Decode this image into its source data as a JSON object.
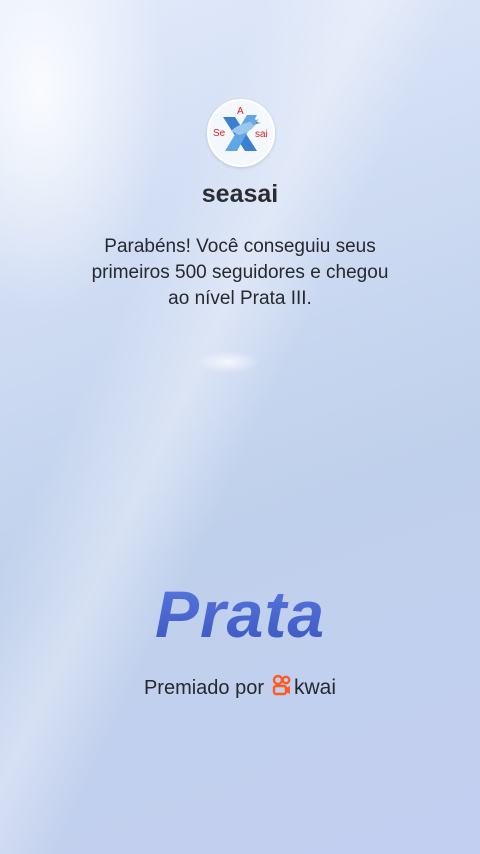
{
  "profile": {
    "avatar_letters": {
      "top": "A",
      "left": "Se",
      "right": "sai"
    },
    "username": "seasai"
  },
  "message": {
    "lines": [
      "Parabéns! Você conseguiu seus",
      "primeiros 500 seguidores e chegou",
      "ao nível Prata III."
    ]
  },
  "level": {
    "name": "Prata",
    "color": "#4560c4"
  },
  "footer": {
    "awarded_by_label": "Premiado por",
    "brand_icon": "kwai-logo-icon",
    "brand_name": "kwai",
    "brand_color": "#ff5a1f"
  }
}
